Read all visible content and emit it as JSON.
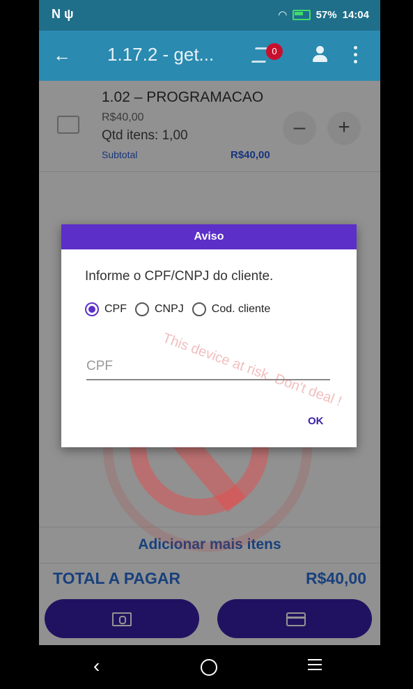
{
  "status_bar": {
    "left_icons": "N ψ",
    "battery": "57%",
    "time": "14:04"
  },
  "app_bar": {
    "title": "1.17.2 - get...",
    "cart_count": "0"
  },
  "item": {
    "name": "1.02 – PROGRAMACAO",
    "price": "R$40,00",
    "qty": "Qtd itens: 1,00",
    "subtotal_label": "Subtotal",
    "subtotal_value": "R$40,00",
    "minus": "–",
    "plus": "+"
  },
  "add_more": "Adicionar mais itens",
  "total": {
    "label": "TOTAL A PAGAR",
    "value": "R$40,00"
  },
  "dialog": {
    "title": "Aviso",
    "message": "Informe o CPF/CNPJ do cliente.",
    "options": [
      "CPF",
      "CNPJ",
      "Cod. cliente"
    ],
    "selected": "CPF",
    "input_placeholder": "CPF",
    "ok_label": "OK"
  },
  "watermark": {
    "text": "This device at risk. Don't deal !"
  },
  "nav": {
    "back": "‹"
  },
  "colors": {
    "appbar": "#2a8ab0",
    "dialog_header": "#5c2fc9",
    "accent_blue": "#2a6fd6",
    "pay_button": "#3a1fa8"
  }
}
